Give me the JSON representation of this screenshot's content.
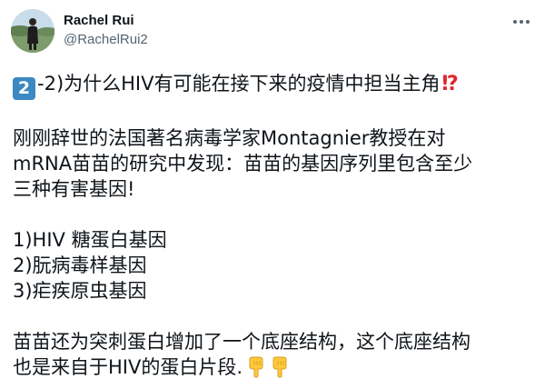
{
  "user": {
    "display_name": "Rachel Rui",
    "handle": "@RachelRui2"
  },
  "tweet": {
    "line1_badge": "2",
    "line1_text": "-2)为什么HIV有可能在接下来的疫情中担当主角",
    "line1_emoji": "⁉",
    "para2": [
      "刚刚辞世的法国著名病毒学家Montagnier教授在对",
      "mRNA苗苗的研究中发现：苗苗的基因序列里包含至少",
      "三种有害基因!"
    ],
    "list": [
      "1)HIV 糖蛋白基因",
      "2)朊病毒样基因",
      "3)疟疾原虫基因"
    ],
    "para4": [
      "苗苗还为突刺蛋白增加了一个底座结构，这个底座结构",
      "也是来自于HIV的蛋白片段."
    ],
    "end_emoji": "point-down-hands"
  },
  "colors": {
    "badge_blue": "#3b88c3",
    "alert_red": "#e0262a",
    "hand_yellow": "#ffc83d",
    "secondary_text": "#536471"
  }
}
